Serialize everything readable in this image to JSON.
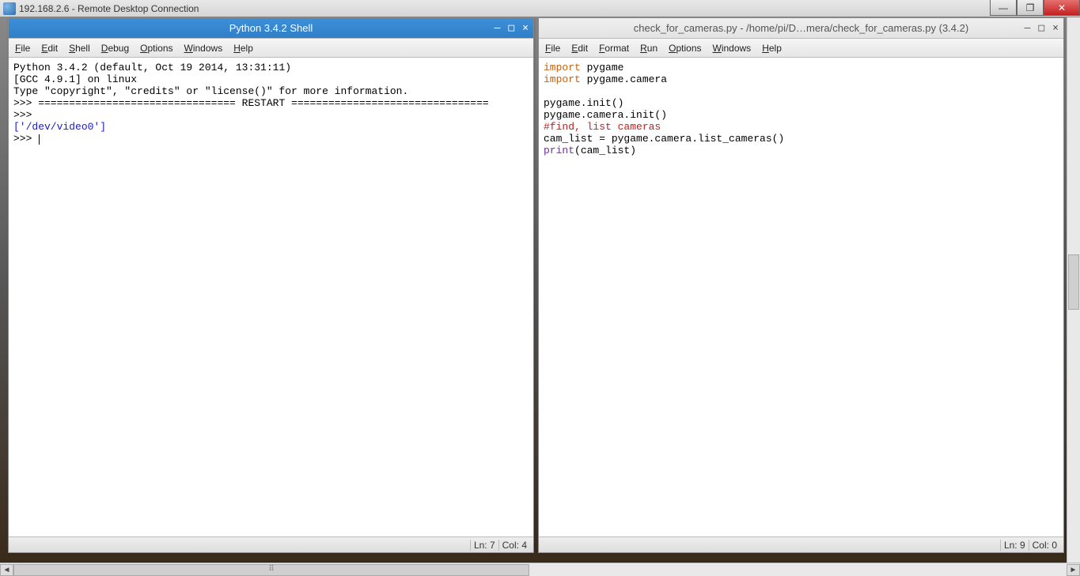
{
  "rdp": {
    "title": "192.168.2.6 - Remote Desktop Connection"
  },
  "win_controls": {
    "min": "—",
    "max": "❐",
    "close": "✕"
  },
  "left_win": {
    "title": "Python 3.4.2 Shell",
    "menus": [
      "File",
      "Edit",
      "Shell",
      "Debug",
      "Options",
      "Windows",
      "Help"
    ],
    "intro1": "Python 3.4.2 (default, Oct 19 2014, 13:31:11)",
    "intro2": "[GCC 4.9.1] on linux",
    "intro3": "Type \"copyright\", \"credits\" or \"license()\" for more information.",
    "restart": ">>> ================================ RESTART ================================",
    "prompt1": ">>> ",
    "output": "['/dev/video0']",
    "prompt2": ">>> ",
    "status_ln": "Ln: 7",
    "status_col": "Col: 4"
  },
  "right_win": {
    "title": "check_for_cameras.py - /home/pi/D…mera/check_for_cameras.py (3.4.2)",
    "menus": [
      "File",
      "Edit",
      "Format",
      "Run",
      "Options",
      "Windows",
      "Help"
    ],
    "code": {
      "l1_kw": "import",
      "l1_rest": " pygame",
      "l2_kw": "import",
      "l2_rest": " pygame.camera",
      "blank": "",
      "l3": "pygame.init()",
      "l4": "pygame.camera.init()",
      "l5_comment": "#find, list cameras",
      "l6": "cam_list = pygame.camera.list_cameras()",
      "l7_func": "print",
      "l7_rest": "(cam_list)"
    },
    "status_ln": "Ln: 9",
    "status_col": "Col: 0"
  },
  "hgrip": "⠿"
}
